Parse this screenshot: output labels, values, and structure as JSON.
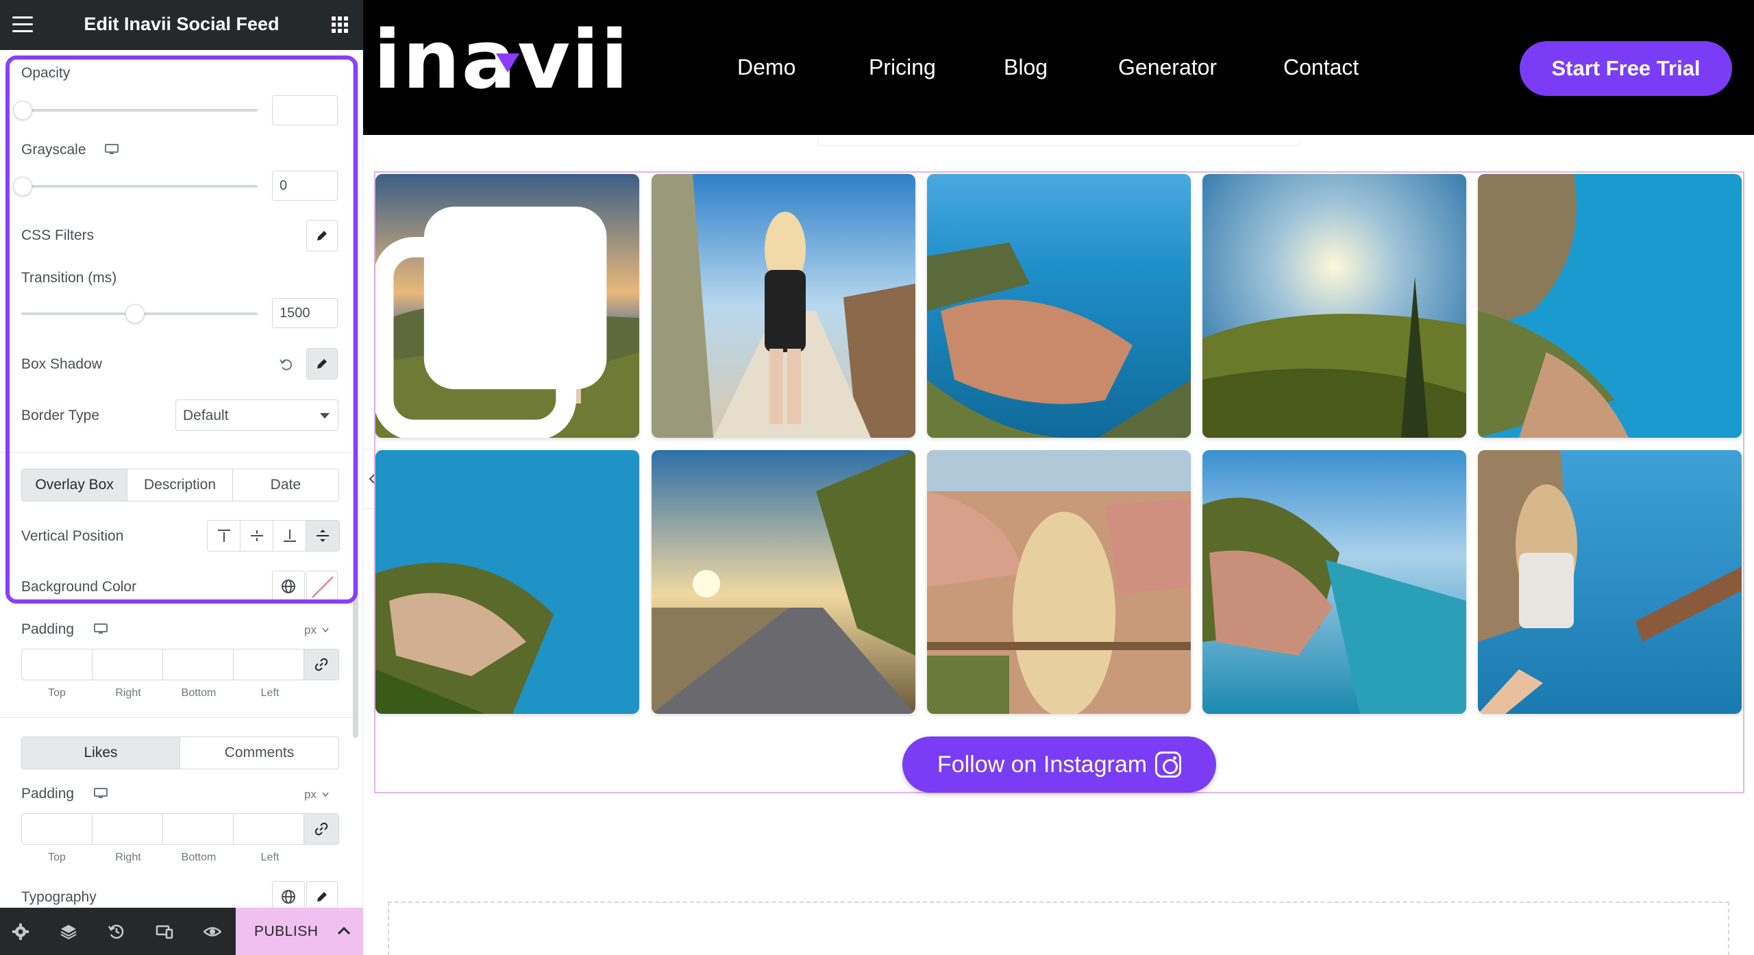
{
  "editor": {
    "title": "Edit Inavii Social Feed",
    "opacity": {
      "label": "Opacity",
      "value": ""
    },
    "grayscale": {
      "label": "Grayscale",
      "value": "0"
    },
    "css_filters": {
      "label": "CSS Filters"
    },
    "transition": {
      "label": "Transition (ms)",
      "value": "1500"
    },
    "box_shadow": {
      "label": "Box Shadow"
    },
    "border_type": {
      "label": "Border Type",
      "value": "Default"
    },
    "tabs": [
      "Overlay Box",
      "Description",
      "Date"
    ],
    "vertical_position": {
      "label": "Vertical Position"
    },
    "background_color": {
      "label": "Background Color"
    },
    "padding1": {
      "label": "Padding",
      "unit": "px",
      "sides": [
        "Top",
        "Right",
        "Bottom",
        "Left"
      ]
    },
    "tabs2": [
      "Likes",
      "Comments"
    ],
    "padding2": {
      "label": "Padding",
      "unit": "px",
      "sides": [
        "Top",
        "Right",
        "Bottom",
        "Left"
      ]
    },
    "typography": {
      "label": "Typography"
    },
    "publish_label": "PUBLISH"
  },
  "site": {
    "logo": "inavii",
    "nav": [
      "Demo",
      "Pricing",
      "Blog",
      "Generator",
      "Contact"
    ],
    "cta": "Start Free Trial",
    "follow_button": "Follow on Instagram"
  },
  "colors": {
    "accent": "#7a3df5",
    "highlight_border": "#8b3dff",
    "panel_dark": "#26292c",
    "publish_bg": "#f0c0f0",
    "feed_frame_border": "#e7b3ee"
  },
  "icons": {
    "menu": "hamburger-icon",
    "apps": "grid-icon",
    "responsive": "monitor-icon",
    "edit": "pencil-icon",
    "reset": "reset-icon",
    "global": "globe-icon",
    "link": "link-icon",
    "collapse": "chevron-left-icon",
    "settings": "gear-icon",
    "navigator": "layers-icon",
    "history": "history-icon",
    "responsive_mode": "responsive-icon",
    "preview": "eye-icon",
    "publish_options": "chevron-up-icon",
    "instagram": "instagram-icon",
    "carousel": "carousel-icon"
  }
}
